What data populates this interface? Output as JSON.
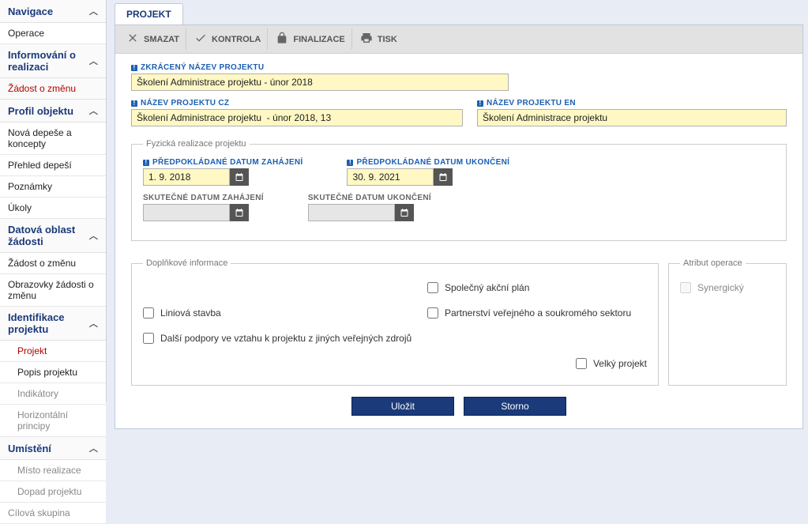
{
  "sidebar": {
    "sections": {
      "navigace": {
        "label": "Navigace"
      },
      "informovani": {
        "label": "Informování o realizaci"
      },
      "zadost_zmenu": {
        "label": "Žádost o změnu"
      },
      "profil": {
        "label": "Profil objektu"
      },
      "datova": {
        "label": "Datová oblast žádosti"
      },
      "identifikace": {
        "label": "Identifikace projektu"
      },
      "umisteni": {
        "label": "Umístění"
      }
    },
    "items": {
      "operace": "Operace",
      "nova_depesa": "Nová depeše a koncepty",
      "prehled": "Přehled depeší",
      "poznamky": "Poznámky",
      "ukoly": "Úkoly",
      "zadost_zmenu2": "Žádost o změnu",
      "obrazovky": "Obrazovky žádosti o změnu",
      "projekt": "Projekt",
      "popis": "Popis projektu",
      "indikatory": "Indikátory",
      "horizontalni": "Horizontální principy",
      "misto": "Místo realizace",
      "dopad": "Dopad projektu",
      "cilova": "Cílová skupina"
    }
  },
  "tab": {
    "title": "PROJEKT"
  },
  "toolbar": {
    "smazat": "SMAZAT",
    "kontrola": "KONTROLA",
    "finalizace": "FINALIZACE",
    "tisk": "TISK"
  },
  "fields": {
    "name_short": {
      "label": "ZKRÁCENÝ NÁZEV PROJEKTU",
      "value": "Školení Administrace projektu - únor 2018"
    },
    "name_cz": {
      "label": "NÁZEV PROJEKTU CZ",
      "value": "Školení Administrace projektu  - únor 2018, 13"
    },
    "name_en": {
      "label": "NÁZEV PROJEKTU EN",
      "value": "Školení Administrace projektu"
    },
    "fs_realizace": "Fyzická realizace projektu",
    "date_start": {
      "label": "PŘEDPOKLÁDANÉ DATUM ZAHÁJENÍ",
      "value": "1. 9. 2018"
    },
    "date_end": {
      "label": "PŘEDPOKLÁDANÉ DATUM UKONČENÍ",
      "value": "30. 9. 2021"
    },
    "date_actual_start": {
      "label": "SKUTEČNÉ DATUM ZAHÁJENÍ",
      "value": ""
    },
    "date_actual_end": {
      "label": "SKUTEČNÉ DATUM UKONČENÍ",
      "value": ""
    },
    "fs_info": "Doplňkové informace",
    "fs_attr": "Atribut operace",
    "chk_spolecny": "Společný akční plán",
    "chk_liniova": "Liniová stavba",
    "chk_partnerstvi": "Partnerství veřejného a soukromého sektoru",
    "chk_dalsi": "Další podpory ve vztahu k projektu z jiných veřejných zdrojů",
    "chk_velky": "Velký projekt",
    "chk_synergicky": "Synergický"
  },
  "buttons": {
    "save": "Uložit",
    "cancel": "Storno"
  }
}
